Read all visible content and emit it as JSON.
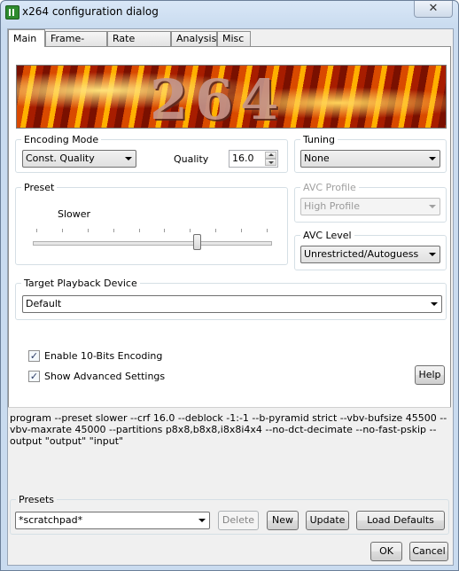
{
  "window": {
    "title": "x264 configuration dialog",
    "close_glyph": "✕"
  },
  "tabs": [
    {
      "label": "Main"
    },
    {
      "label": "Frame-Type"
    },
    {
      "label": "Rate Control"
    },
    {
      "label": "Analysis"
    },
    {
      "label": "Misc"
    }
  ],
  "banner": {
    "text": "264"
  },
  "encoding_mode": {
    "legend": "Encoding Mode",
    "mode": "Const. Quality",
    "quality_label": "Quality",
    "quality_value": "16.0"
  },
  "tuning": {
    "legend": "Tuning",
    "value": "None"
  },
  "preset": {
    "legend": "Preset",
    "value_label": "Slower",
    "slider_position": 0.7
  },
  "avc_profile": {
    "legend": "AVC Profile",
    "value": "High Profile"
  },
  "avc_level": {
    "legend": "AVC Level",
    "value": "Unrestricted/Autoguess"
  },
  "target_device": {
    "legend": "Target Playback Device",
    "value": "Default"
  },
  "options": {
    "ten_bit_label": "Enable 10-Bits Encoding",
    "ten_bit_checked": true,
    "advanced_label": "Show Advanced Settings",
    "advanced_checked": true,
    "check_glyph": "✓",
    "help_label": "Help"
  },
  "command_line": "program --preset slower --crf 16.0 --deblock -1:-1 --b-pyramid strict --vbv-bufsize 45500 --vbv-maxrate 45000 --partitions p8x8,b8x8,i8x8i4x4 --no-dct-decimate --no-fast-pskip --output \"output\" \"input\"",
  "presets": {
    "legend": "Presets",
    "value": "*scratchpad*",
    "delete_label": "Delete",
    "new_label": "New",
    "update_label": "Update",
    "load_defaults_label": "Load Defaults"
  },
  "footer": {
    "ok_label": "OK",
    "cancel_label": "Cancel"
  }
}
